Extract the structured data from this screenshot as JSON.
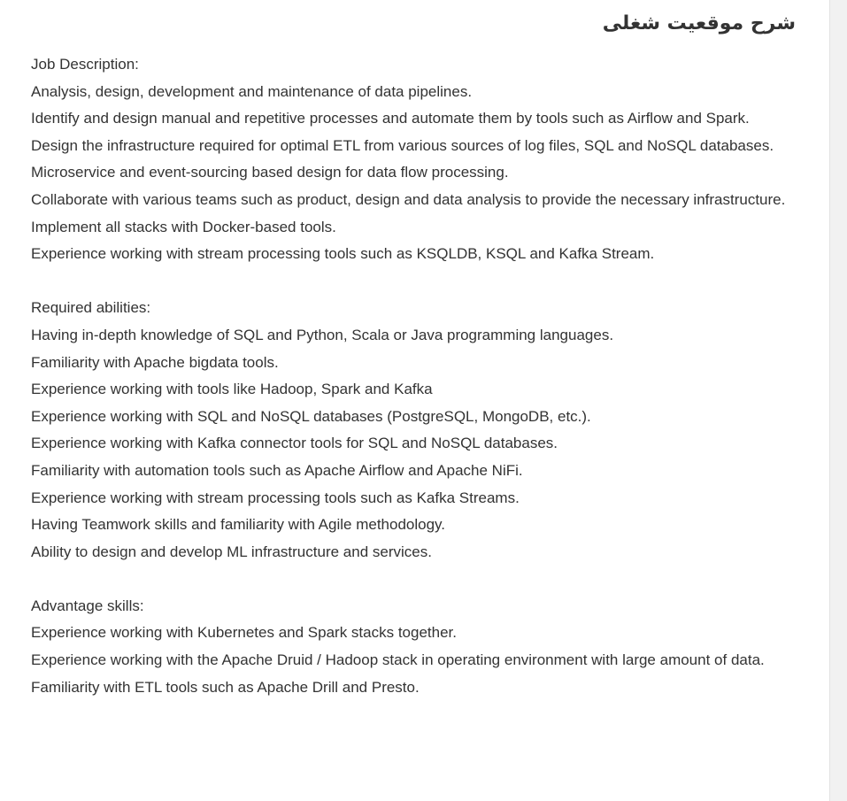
{
  "page": {
    "title": "شرح موقعیت شغلی"
  },
  "sections": [
    {
      "heading": "Job Description:",
      "lines": [
        "Analysis, design, development and maintenance of data pipelines.",
        "Identify and design manual and repetitive processes and automate them by tools such as Airflow and Spark.",
        "Design the infrastructure required for optimal ETL from various sources of log files, SQL and NoSQL databases.",
        "Microservice and event-sourcing based design for data flow processing.",
        "Collaborate with various teams such as product, design and data analysis to provide the necessary infrastructure.",
        "Implement all stacks with Docker-based tools.",
        "Experience working with stream processing tools such as KSQLDB, KSQL and Kafka Stream."
      ]
    },
    {
      "heading": "Required abilities:",
      "lines": [
        "Having in-depth knowledge of SQL and Python, Scala or Java programming languages.",
        "Familiarity with Apache bigdata tools.",
        "Experience working with tools like Hadoop, Spark and Kafka",
        "Experience working with SQL and NoSQL databases (PostgreSQL, MongoDB, etc.).",
        "Experience working with Kafka connector tools for SQL and NoSQL databases.",
        "Familiarity with automation tools such as Apache Airflow and Apache NiFi.",
        "Experience working with stream processing tools such as Kafka Streams.",
        "Having Teamwork skills and familiarity with Agile methodology.",
        "Ability to design and develop ML infrastructure and services."
      ]
    },
    {
      "heading": "Advantage skills:",
      "lines": [
        "Experience working with Kubernetes and Spark stacks together.",
        "Experience working with the Apache Druid / Hadoop stack in operating environment with large amount of data.",
        "Familiarity with ETL tools such as Apache Drill and Presto."
      ]
    }
  ]
}
